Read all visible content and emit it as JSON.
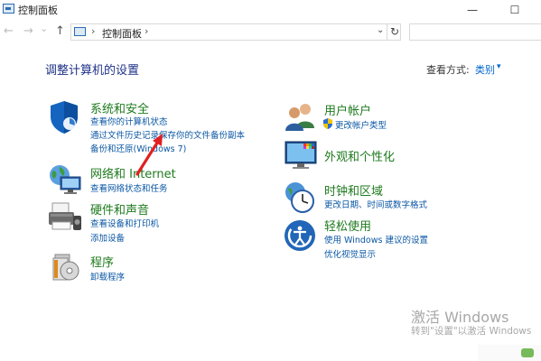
{
  "window": {
    "title": "控制面板",
    "minimize_glyph": "—",
    "maximize_glyph": "☐"
  },
  "nav": {
    "back_glyph": "←",
    "forward_glyph": "→",
    "recent_glyph": "⌄",
    "up_glyph": "↑"
  },
  "address": {
    "separator": "›",
    "crumb": "控制面板",
    "separator2": "›",
    "dropdown_glyph": "⌄",
    "refresh_glyph": "↻"
  },
  "main": {
    "heading": "调整计算机的设置",
    "view_by_label": "查看方式:",
    "view_by_value": "类别",
    "view_by_caret": "▾"
  },
  "categories": {
    "system": {
      "title": "系统和安全",
      "links": [
        "查看你的计算机状态",
        "通过文件历史记录保存你的文件备份副本",
        "备份和还原(Windows 7)"
      ]
    },
    "network": {
      "title": "网络和 Internet",
      "links": [
        "查看网络状态和任务"
      ]
    },
    "hardware": {
      "title": "硬件和声音",
      "links": [
        "查看设备和打印机",
        "添加设备"
      ]
    },
    "programs": {
      "title": "程序",
      "links": [
        "卸载程序"
      ]
    },
    "users": {
      "title": "用户帐户",
      "links": [
        "更改帐户类型"
      ]
    },
    "appearance": {
      "title": "外观和个性化",
      "links": []
    },
    "clock": {
      "title": "时钟和区域",
      "links": [
        "更改日期、时间或数字格式"
      ]
    },
    "ease": {
      "title": "轻松使用",
      "links": [
        "使用 Windows 建议的设置",
        "优化视觉显示"
      ]
    }
  },
  "watermark": {
    "line1": "激活 Windows",
    "line2": "转到\"设置\"以激活 Windows"
  },
  "colors": {
    "category_title": "#1e7a1e",
    "link": "#0b57a4",
    "heading": "#1e3287",
    "annotation_arrow": "#e02020"
  }
}
